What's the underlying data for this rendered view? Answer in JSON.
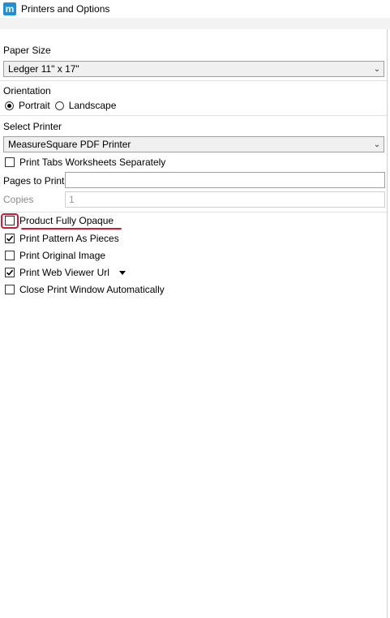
{
  "window": {
    "title": "Printers and Options",
    "icon": "m"
  },
  "paper_size": {
    "label": "Paper Size",
    "value": "Ledger 11\" x 17\""
  },
  "orientation": {
    "label": "Orientation",
    "portrait": "Portrait",
    "landscape": "Landscape",
    "selected": "Portrait"
  },
  "printer": {
    "label": "Select Printer",
    "value": "MeasureSquare PDF Printer"
  },
  "options": {
    "print_tabs": "Print Tabs Worksheets Separately",
    "pages_label": "Pages to Print",
    "pages_value": "",
    "copies_label": "Copies",
    "copies_value": "1",
    "product_opaque": "Product Fully Opaque",
    "print_pattern": "Print Pattern As Pieces",
    "print_original": "Print Original Image",
    "print_web_url": "Print Web Viewer Url",
    "close_window": "Close Print Window Automatically"
  },
  "checked": {
    "print_tabs": false,
    "product_opaque": false,
    "print_pattern": true,
    "print_original": false,
    "print_web_url": true,
    "close_window": false
  },
  "colors": {
    "accent_icon": "#1e90d6",
    "highlight": "#d11a3a"
  }
}
